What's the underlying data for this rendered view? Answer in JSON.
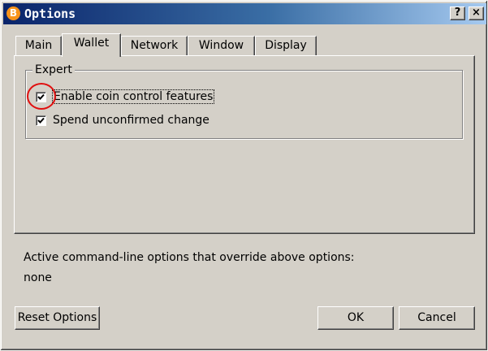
{
  "window": {
    "title": "Options",
    "app_icon_glyph": "B",
    "help_label": "?",
    "close_label": "×"
  },
  "tabs": [
    {
      "label": "Main",
      "active": false
    },
    {
      "label": "Wallet",
      "active": true
    },
    {
      "label": "Network",
      "active": false
    },
    {
      "label": "Window",
      "active": false
    },
    {
      "label": "Display",
      "active": false
    }
  ],
  "expert": {
    "group_title": "Expert",
    "coin_control": {
      "label": "Enable coin control features",
      "checked": true
    },
    "spend_unconfirmed": {
      "label": "Spend unconfirmed change",
      "checked": true
    }
  },
  "info": {
    "title": "Active command-line options that override above options:",
    "value": "none"
  },
  "buttons": {
    "reset": "Reset Options",
    "ok": "OK",
    "cancel": "Cancel"
  },
  "colors": {
    "accent_titlebar": "#0a246a",
    "highlight_circle": "#e01010",
    "bitcoin_orange": "#f7931a"
  },
  "icons": {
    "app": "bitcoin-icon",
    "check": "checkmark-icon"
  }
}
